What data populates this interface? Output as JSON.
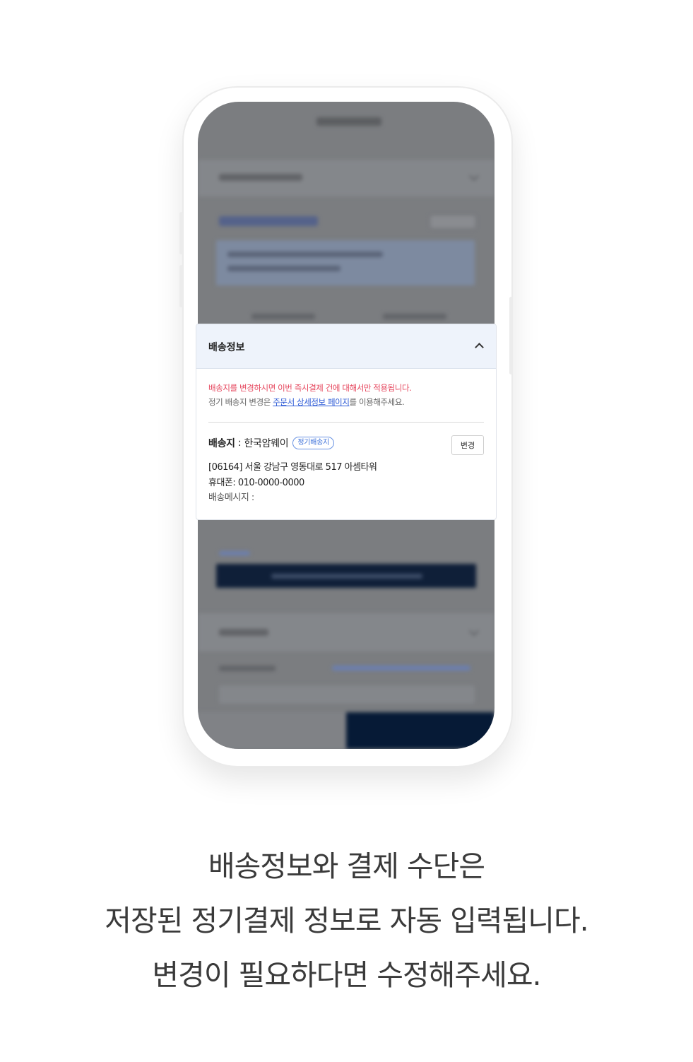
{
  "card": {
    "title": "배송정보",
    "notice_line1": "배송지를 변경하시면 이번 즉시결제 건에 대해서만 적용됩니다.",
    "notice_line2_prefix": "정기 배송지 변경은 ",
    "notice_line2_link": "주문서 상세정보 페이지",
    "notice_line2_suffix": "를 이용해주세요.",
    "address_label": "배송지",
    "address_separator": " : ",
    "address_name": "한국암웨이",
    "address_badge": "정기배송지",
    "change_button": "변경",
    "address_line": "[06164] 서울 강남구 영동대로 517 아셈타워",
    "phone_line": "휴대폰: 010-0000-0000",
    "message_label": "배송메시지 :"
  },
  "caption": {
    "line1": "배송정보와 결제 수단은",
    "line2": "저장된 정기결제 정보로 자동 입력됩니다.",
    "line3": "변경이 필요하다면 수정해주세요."
  },
  "colors": {
    "notice_red": "#e6475e",
    "link_blue": "#2e5bd6",
    "header_bg": "#eef3fb",
    "overlay_gray": "#7b7d80",
    "navy": "#061a36"
  },
  "icons": {
    "collapse": "chevron-up-icon"
  }
}
